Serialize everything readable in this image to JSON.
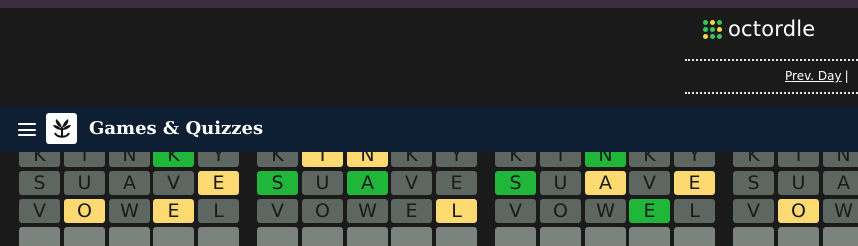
{
  "header": {
    "app_name": "octordle",
    "prev_day_label": "Prev. Day",
    "prev_day_separator": "|",
    "logo_dot_colors": [
      "#34c759",
      "#f6d743",
      "#34c759",
      "#34c759",
      "#34c759",
      "#f6d743",
      "#f6d743",
      "#34c759",
      "#34c759"
    ]
  },
  "nav": {
    "title": "Games & Quizzes",
    "logo_icon": "nyt-games-logo-icon",
    "menu_icon": "hamburger-menu-icon"
  },
  "colors": {
    "green": "#1fb63a",
    "yellow": "#fcd971",
    "gray": "#5d6660",
    "empty": "#7b837e",
    "background": "#1a1a1a",
    "nav_background": "#0f1f33"
  },
  "boards": [
    {
      "rows": [
        [
          {
            "letter": "K",
            "state": "gray"
          },
          {
            "letter": "I",
            "state": "gray"
          },
          {
            "letter": "N",
            "state": "gray"
          },
          {
            "letter": "K",
            "state": "green"
          },
          {
            "letter": "Y",
            "state": "gray"
          }
        ],
        [
          {
            "letter": "S",
            "state": "gray"
          },
          {
            "letter": "U",
            "state": "gray"
          },
          {
            "letter": "A",
            "state": "gray"
          },
          {
            "letter": "V",
            "state": "gray"
          },
          {
            "letter": "E",
            "state": "yellow"
          }
        ],
        [
          {
            "letter": "V",
            "state": "gray"
          },
          {
            "letter": "O",
            "state": "yellow"
          },
          {
            "letter": "W",
            "state": "gray"
          },
          {
            "letter": "E",
            "state": "yellow"
          },
          {
            "letter": "L",
            "state": "gray"
          }
        ],
        [
          {
            "letter": "",
            "state": "empty"
          },
          {
            "letter": "",
            "state": "empty"
          },
          {
            "letter": "",
            "state": "empty"
          },
          {
            "letter": "",
            "state": "empty"
          },
          {
            "letter": "",
            "state": "empty"
          }
        ]
      ]
    },
    {
      "rows": [
        [
          {
            "letter": "K",
            "state": "gray"
          },
          {
            "letter": "I",
            "state": "yellow"
          },
          {
            "letter": "N",
            "state": "yellow"
          },
          {
            "letter": "K",
            "state": "gray"
          },
          {
            "letter": "Y",
            "state": "gray"
          }
        ],
        [
          {
            "letter": "S",
            "state": "green"
          },
          {
            "letter": "U",
            "state": "gray"
          },
          {
            "letter": "A",
            "state": "green"
          },
          {
            "letter": "V",
            "state": "gray"
          },
          {
            "letter": "E",
            "state": "gray"
          }
        ],
        [
          {
            "letter": "V",
            "state": "gray"
          },
          {
            "letter": "O",
            "state": "gray"
          },
          {
            "letter": "W",
            "state": "gray"
          },
          {
            "letter": "E",
            "state": "gray"
          },
          {
            "letter": "L",
            "state": "yellow"
          }
        ],
        [
          {
            "letter": "",
            "state": "empty"
          },
          {
            "letter": "",
            "state": "empty"
          },
          {
            "letter": "",
            "state": "empty"
          },
          {
            "letter": "",
            "state": "empty"
          },
          {
            "letter": "",
            "state": "empty"
          }
        ]
      ]
    },
    {
      "rows": [
        [
          {
            "letter": "K",
            "state": "gray"
          },
          {
            "letter": "I",
            "state": "gray"
          },
          {
            "letter": "N",
            "state": "green"
          },
          {
            "letter": "K",
            "state": "gray"
          },
          {
            "letter": "Y",
            "state": "gray"
          }
        ],
        [
          {
            "letter": "S",
            "state": "green"
          },
          {
            "letter": "U",
            "state": "gray"
          },
          {
            "letter": "A",
            "state": "yellow"
          },
          {
            "letter": "V",
            "state": "gray"
          },
          {
            "letter": "E",
            "state": "yellow"
          }
        ],
        [
          {
            "letter": "V",
            "state": "gray"
          },
          {
            "letter": "O",
            "state": "gray"
          },
          {
            "letter": "W",
            "state": "gray"
          },
          {
            "letter": "E",
            "state": "green"
          },
          {
            "letter": "L",
            "state": "gray"
          }
        ],
        [
          {
            "letter": "",
            "state": "empty"
          },
          {
            "letter": "",
            "state": "empty"
          },
          {
            "letter": "",
            "state": "empty"
          },
          {
            "letter": "",
            "state": "empty"
          },
          {
            "letter": "",
            "state": "empty"
          }
        ]
      ]
    },
    {
      "rows": [
        [
          {
            "letter": "K",
            "state": "gray"
          },
          {
            "letter": "I",
            "state": "gray"
          },
          {
            "letter": "N",
            "state": "gray"
          }
        ],
        [
          {
            "letter": "S",
            "state": "gray"
          },
          {
            "letter": "U",
            "state": "gray"
          },
          {
            "letter": "A",
            "state": "gray"
          }
        ],
        [
          {
            "letter": "V",
            "state": "gray"
          },
          {
            "letter": "O",
            "state": "yellow"
          },
          {
            "letter": "W",
            "state": "gray"
          }
        ],
        [
          {
            "letter": "",
            "state": "empty"
          },
          {
            "letter": "",
            "state": "empty"
          },
          {
            "letter": "",
            "state": "empty"
          }
        ]
      ]
    }
  ]
}
